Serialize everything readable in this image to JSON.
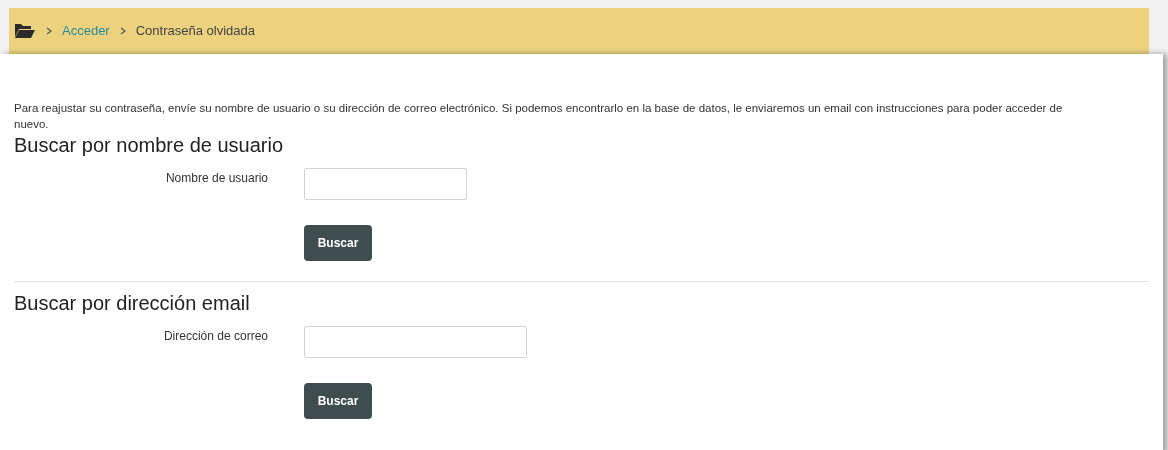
{
  "breadcrumb": [
    {
      "label": "Acceder",
      "kind": "link"
    },
    {
      "label": "Contraseña olvidada",
      "kind": "current"
    }
  ],
  "intro": "Para reajustar su contraseña, envíe su nombre de usuario o su dirección de correo electrónico. Si podemos encontrarlo en la base de datos, le enviaremos un email con instrucciones para poder acceder de nuevo.",
  "sections": [
    {
      "heading": "Buscar por nombre de usuario",
      "field_label": "Nombre de usuario",
      "kind": "short",
      "button": "Buscar"
    },
    {
      "heading": "Buscar por dirección email",
      "field_label": "Dirección de correo",
      "kind": "long",
      "button": "Buscar"
    }
  ]
}
